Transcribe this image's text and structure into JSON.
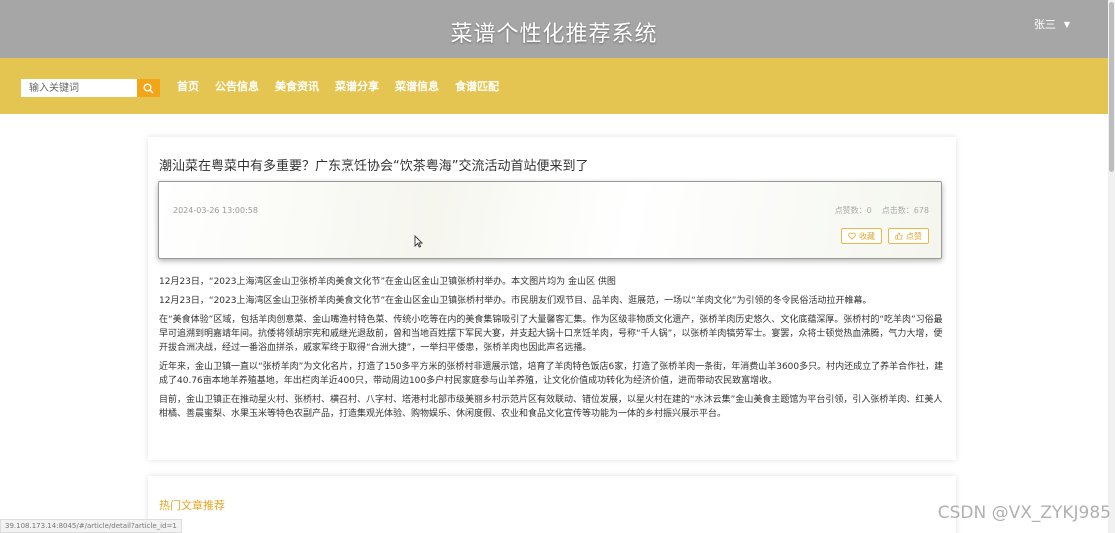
{
  "header": {
    "site_title": "菜谱个性化推荐系统",
    "user_name": "张三",
    "caret": "▼"
  },
  "nav": {
    "search_placeholder": "输入关键词",
    "items": [
      "首页",
      "公告信息",
      "美食资讯",
      "菜谱分享",
      "菜谱信息",
      "食谱匹配"
    ]
  },
  "article": {
    "title": "潮汕菜在粤菜中有多重要？广东烹饪协会“饮茶粤海”交流活动首站便来到了",
    "date": "2024-03-26 13:00:58",
    "likes_label": "点赞数：0",
    "clicks_label": "点击数：678",
    "favorite_label": "收藏",
    "like_label": "点赞",
    "paragraphs": [
      "12月23日，“2023上海湾区金山卫张桥羊肉美食文化节”在金山区金山卫镇张桥村举办。本文图片均为 金山区 供图",
      "12月23日，“2023上海湾区金山卫张桥羊肉美食文化节”在金山区金山卫镇张桥村举办。市民朋友们观节目、品羊肉、逛展范，一场以“羊肉文化”为引领的冬令民俗活动拉开帷幕。",
      "在“美食体验”区域，包括羊肉创意菜、金山嘴渔村特色菜、传统小吃等在内的美食集锦吸引了大量馨客汇集。作为区级非物质文化遗产，张桥羊肉历史悠久、文化底蕴深厚。张桥村的“吃羊肉”习俗最早可追溯到明嘉靖年间。抗倭将领胡宗宪和戚继光退敌前，曾和当地百姓摆下军民大宴，并支起大锅十口烹饪羊肉，号称“千人锅”，以张桥羊肉犒劳军士。宴罢，众将士顿觉热血沸腾，气力大增，便开拔合洲决战，经过一番浴血拼杀，戚家军终于取得“合洲大捷”，一举扫平倭患，张桥羊肉也因此声名远播。",
      "近年来，金山卫镇一直以“张桥羊肉”为文化名片，打造了150多平方米的张桥村非遗展示馆，培育了羊肉特色饭店6家，打造了张桥羊肉一条街，年消费山羊3600多只。村内还成立了养羊合作社，建成了40.76亩本地羊养殖基地，年出栏肉羊近400只，带动周边100多户村民家庭参与山羊养殖，让文化价值成功转化为经济价值，进而带动农民致富增收。",
      "目前，金山卫镇正在推动星火村、张桥村、横召村、八字村、塔港村北部市级美丽乡村示范片区有效联动、错位发展，以星火村在建的“水沐云集”金山美食主题馆为平台引领，引入张桥羊肉、红美人柑橘、善晨蜜梨、水果玉米等特色农副产品，打造集观光体验、购物娱乐、休闲度假、农业和食品文化宣传等功能为一体的乡村振兴展示平台。"
    ]
  },
  "hot": {
    "title": "热门文章推荐"
  },
  "status_url": "39.108.173.14:8045/#/article/detail?article_id=1",
  "watermark": "CSDN @VX_ZYKJ985"
}
